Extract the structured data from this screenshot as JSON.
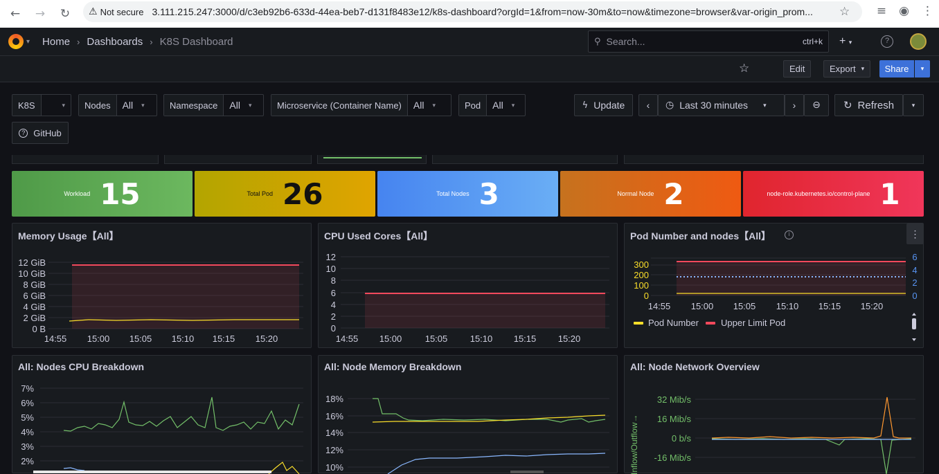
{
  "browser": {
    "not_secure": "Not secure",
    "url": "3.111.215.247:3000/d/c3eb92b6-633d-44ea-beb7-d131f8483e12/k8s-dashboard?orgId=1&from=now-30m&to=now&timezone=browser&var-origin_prom..."
  },
  "nav": {
    "crumbs": [
      "Home",
      "Dashboards",
      "K8S Dashboard"
    ],
    "search_placeholder": "Search...",
    "search_hint": "ctrl+k"
  },
  "toolbar": {
    "edit": "Edit",
    "export": "Export",
    "share": "Share"
  },
  "vars": [
    {
      "label": "K8S",
      "value": ""
    },
    {
      "label": "Nodes",
      "value": "All"
    },
    {
      "label": "Namespace",
      "value": "All"
    },
    {
      "label": "Microservice (Container Name)",
      "value": "All"
    },
    {
      "label": "Pod",
      "value": "All"
    }
  ],
  "controls": {
    "update": "Update",
    "timerange": "Last 30 minutes",
    "refresh": "Refresh",
    "github": "GitHub"
  },
  "stats": [
    {
      "label": "Workload",
      "value": "15",
      "color": "#56a64b"
    },
    {
      "label": "Total Pod",
      "value": "26",
      "color": "#c6a800"
    },
    {
      "label": "Total Nodes",
      "value": "3",
      "color": "#5794f2"
    },
    {
      "label": "Normal Node",
      "value": "2",
      "color": "#e0752d"
    },
    {
      "label": "node-role.kubernetes.io/control-plane",
      "value": "1",
      "color": "#e02f44"
    }
  ],
  "panels": {
    "mem": "Memory Usage【All】",
    "cpu": "CPU Used Cores【All】",
    "pod": "Pod Number and nodes【All】",
    "ncpu": "All:  Nodes CPU Breakdown",
    "nmem": "All:  Node Memory Breakdown",
    "nnet": "All:  Node Network Overview"
  },
  "chart_data": [
    {
      "type": "line",
      "title": "Memory Usage【All】",
      "y_ticks": [
        "12 GiB",
        "10 GiB",
        "8 GiB",
        "6 GiB",
        "4 GiB",
        "2 GiB",
        "0 B"
      ],
      "x_ticks": [
        "14:55",
        "15:00",
        "15:05",
        "15:10",
        "15:15",
        "15:20"
      ],
      "series": [
        {
          "values": [
            11.5,
            11.5
          ],
          "color": "#f2495c"
        },
        {
          "values": [
            1.5,
            1.6
          ],
          "color": "#fade2a"
        }
      ]
    },
    {
      "type": "line",
      "title": "CPU Used Cores【All】",
      "y_ticks": [
        "12",
        "10",
        "8",
        "6",
        "4",
        "2",
        "0"
      ],
      "x_ticks": [
        "14:55",
        "15:00",
        "15:05",
        "15:10",
        "15:15",
        "15:20"
      ],
      "series": [
        {
          "values": [
            6,
            6
          ],
          "color": "#f2495c"
        }
      ]
    },
    {
      "type": "line",
      "title": "Pod Number and nodes【All】",
      "y_ticks": [
        "300",
        "200",
        "100",
        "0"
      ],
      "y2_ticks": [
        "6",
        "4",
        "2",
        "0"
      ],
      "x_ticks": [
        "14:55",
        "15:00",
        "15:05",
        "15:10",
        "15:15",
        "15:20"
      ],
      "legend": [
        "Pod Number",
        "Upper Limit Pod"
      ],
      "series": [
        {
          "name": "Pod Number",
          "values": [
            26,
            26
          ],
          "color": "#fade2a"
        },
        {
          "name": "Upper Limit Pod",
          "values": [
            330,
            330
          ],
          "color": "#f2495c"
        }
      ]
    },
    {
      "type": "line",
      "title": "All:  Nodes CPU Breakdown",
      "y_ticks": [
        "7%",
        "6%",
        "5%",
        "4%",
        "3%",
        "2%"
      ]
    },
    {
      "type": "line",
      "title": "All:  Node Memory Breakdown",
      "y_ticks": [
        "18%",
        "16%",
        "14%",
        "12%",
        "10%"
      ]
    },
    {
      "type": "line",
      "title": "All:  Node Network Overview",
      "y_ticks": [
        "32 Mib/s",
        "16 Mib/s",
        "0 b/s",
        "-16 Mib/s"
      ],
      "ylabel": "-Inflow/Outflow→"
    }
  ]
}
